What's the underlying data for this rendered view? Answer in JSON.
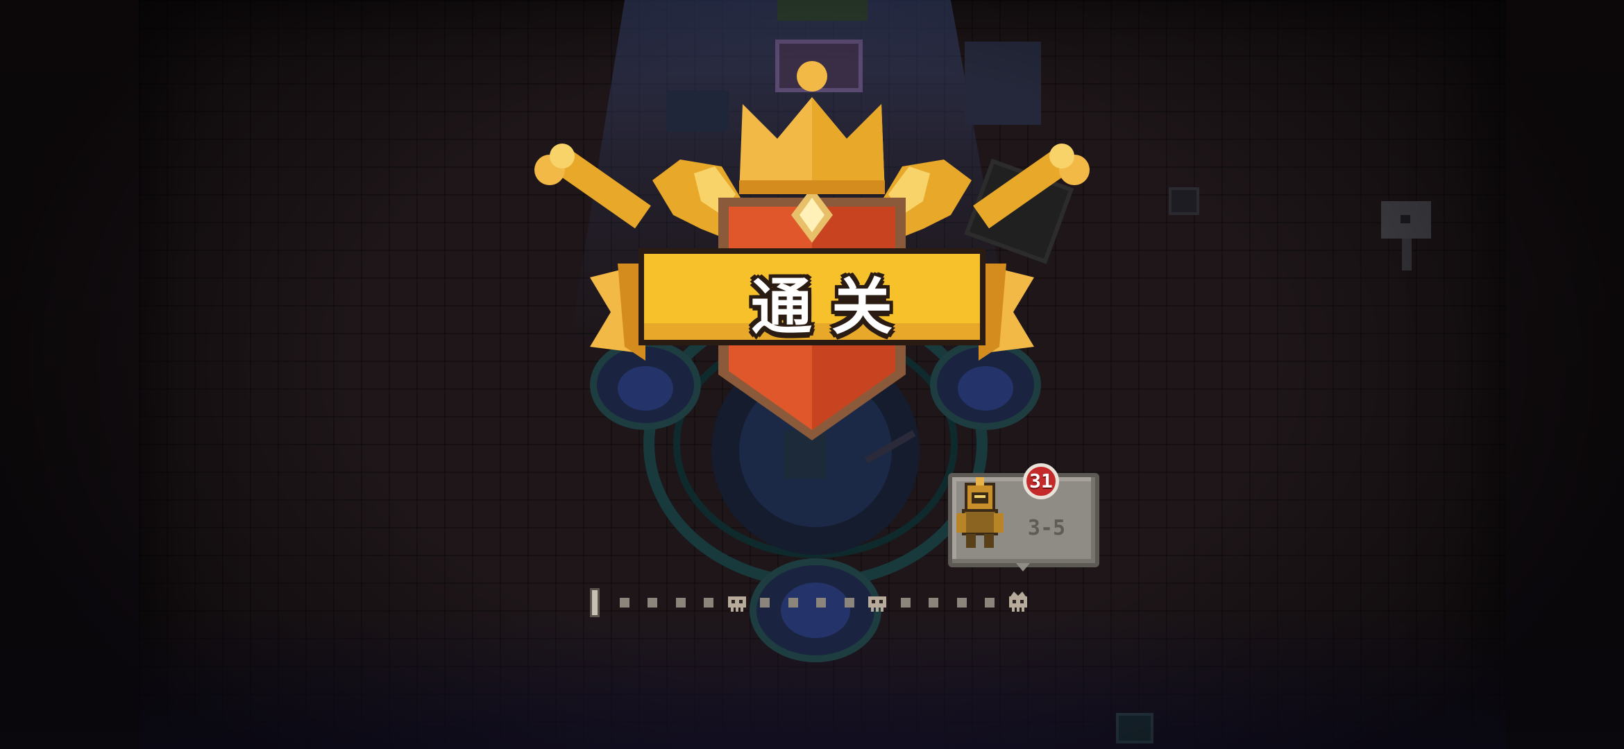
{
  "banner": {
    "title": "通关"
  },
  "level_card": {
    "stage": "3-5",
    "player_level": "31"
  },
  "stage_progress": {
    "nodes": [
      "start",
      "room",
      "room",
      "room",
      "room",
      "boss",
      "room",
      "room",
      "room",
      "room",
      "boss",
      "room",
      "room",
      "room",
      "room",
      "crown-boss"
    ],
    "current_index": 15
  },
  "colors": {
    "banner_yellow": "#f7c12b",
    "crest_orange": "#e0572c",
    "gold": "#e8a92a",
    "badge_red": "#c42a2a"
  }
}
